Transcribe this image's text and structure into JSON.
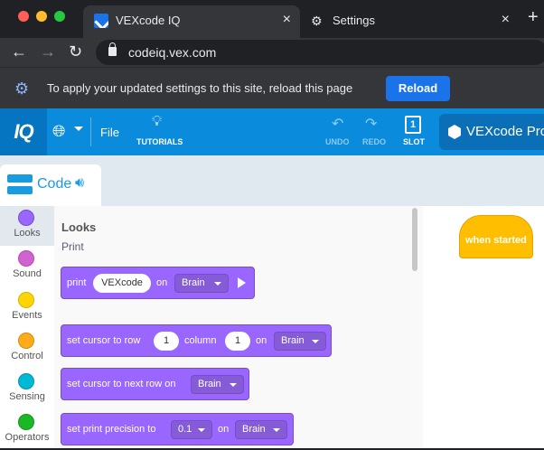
{
  "browser": {
    "tabs": [
      {
        "title": "VEXcode IQ",
        "active": true,
        "close": "×"
      },
      {
        "title": "Settings",
        "active": false,
        "close": "×"
      }
    ],
    "new_tab": "+",
    "url": "codeiq.vex.com",
    "infobar": {
      "message": "To apply your updated settings to this site, reload this page",
      "reload_label": "Reload"
    }
  },
  "app": {
    "logo": "IQ",
    "file_label": "File",
    "tutorials_label": "TUTORIALS",
    "undo_label": "UNDO",
    "redo_label": "REDO",
    "slot_number": "1",
    "slot_label": "SLOT",
    "project_name": "VEXcode Pro"
  },
  "workspace": {
    "code_tab_label": "Code",
    "categories": [
      {
        "label": "Looks",
        "color": "#9966ff",
        "active": true
      },
      {
        "label": "Sound",
        "color": "#cf63cf"
      },
      {
        "label": "Events",
        "color": "#ffd500"
      },
      {
        "label": "Control",
        "color": "#ffab19"
      },
      {
        "label": "Sensing",
        "color": "#00b9d6"
      },
      {
        "label": "Operators",
        "color": "#1ab826"
      }
    ],
    "flyout": {
      "title": "Looks",
      "subtitle": "Print",
      "blocks": {
        "print": {
          "word": "print",
          "value": "VEXcode",
          "on": "on",
          "target": "Brain"
        },
        "cursor_row": {
          "text": "set cursor to row",
          "row": "1",
          "column_label": "column",
          "column": "1",
          "on": "on",
          "target": "Brain"
        },
        "cursor_next": {
          "text": "set cursor to next row on",
          "target": "Brain"
        },
        "precision": {
          "text": "set print precision to",
          "value": "0.1",
          "on": "on",
          "target": "Brain"
        }
      }
    },
    "canvas": {
      "hat_label": "when started"
    }
  },
  "colors": {
    "accent": "#0a8bdc",
    "looks": "#9966ff",
    "events": "#ffbf00"
  }
}
